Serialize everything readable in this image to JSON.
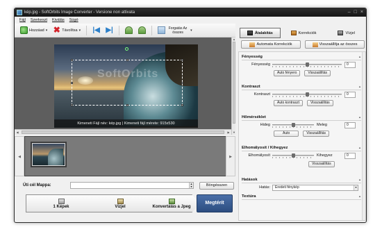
{
  "window": {
    "title": "kép.jpg - SoftOrbits Image Converter - Versione non attivata",
    "controls": [
      "–",
      "□",
      "×"
    ]
  },
  "menu": [
    "Fájl",
    "Szerkeszt",
    "Kiválás",
    "Súgó"
  ],
  "toolbar": {
    "add_label": "Hozzáad",
    "remove_label": "Távolítsa",
    "rotate_all_label": "Forgatás Az összes"
  },
  "viewer": {
    "watermark": "SoftOrbits",
    "info": "Kimeneti Fájl név: kép.jpg | Kimeneti fájl mérete: 915x530"
  },
  "destination": {
    "label": "Úti cél Mappa:",
    "value": "",
    "browse_label": "Böngésszen"
  },
  "steps": [
    {
      "label": "1 Képek"
    },
    {
      "label": "Vízjel"
    },
    {
      "label": "Konvertálás a Jpeg"
    }
  ],
  "run_label": "Megtérít",
  "tabs": [
    {
      "label": "Átalakítás",
      "active": true
    },
    {
      "label": "Korrekciók",
      "active": false
    },
    {
      "label": "Vízjel",
      "active": false
    }
  ],
  "top_buttons": {
    "auto_correct": "Automata Korrekciók",
    "reset_all": "Visszaállítja az összes"
  },
  "sections": {
    "brightness": {
      "title": "Fényesség",
      "label": "Fényesség",
      "value": "0",
      "slider_fraction": 0.5,
      "auto_label": "Auto fényero",
      "reset_label": "Visszaállítás"
    },
    "contrast": {
      "title": "Kontraszt",
      "label": "Kontraszt",
      "value": "0",
      "slider_fraction": 0.5,
      "auto_label": "Auto kontraszt",
      "reset_label": "Visszaállítás"
    },
    "temperature": {
      "title": "Hőmérséklet",
      "left_label": "Hideg",
      "right_label": "Meleg",
      "value": "0",
      "slider_fraction": 0.5,
      "auto_label": "Auto",
      "reset_label": "Visszaállítás"
    },
    "blur": {
      "title": "Elhomályosít / Kihegyez",
      "left_label": "Elhomályosít",
      "right_label": "Kihegyez",
      "value": "0",
      "slider_fraction": 0.5,
      "reset_label": "Visszaállítás"
    },
    "effects": {
      "title": "Hatások",
      "label": "Hatás:",
      "selected": "Eredeti fénykép"
    },
    "texture": {
      "title": "Textúra"
    }
  },
  "colors": {
    "titlebar": "#1e1e1e",
    "run_button": "#2f5288",
    "remove_icon": "#d3222a",
    "nav_icon": "#2b7fc9"
  },
  "icons": {
    "add": "add-image-icon",
    "remove": "red-x-icon",
    "first": "first-icon",
    "last": "last-icon",
    "rotate_left": "rotate-left-icon",
    "rotate_right": "rotate-right-icon",
    "rotate_all": "rotate-all-icon"
  }
}
